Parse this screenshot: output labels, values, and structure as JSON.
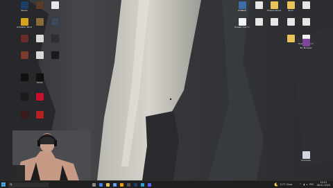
{
  "desktop": {
    "left_icons": [
      {
        "label": "Steam",
        "color": "#1b3f66"
      },
      {
        "label": "",
        "color": "#5a3a28"
      },
      {
        "label": "",
        "color": "#e8e8e8"
      },
      {
        "label": "Activator Windows",
        "color": "#d7a21f"
      },
      {
        "label": "",
        "color": "#8a6a3a"
      },
      {
        "label": "",
        "color": "#3a4a5a"
      },
      {
        "label": "",
        "color": "#6b2b2b"
      },
      {
        "label": "",
        "color": "#d9d9d9"
      },
      {
        "label": "",
        "color": "#2f2f2f"
      },
      {
        "label": "",
        "color": "#7a3b2a"
      },
      {
        "label": "",
        "color": "#d9d9d9"
      },
      {
        "label": "",
        "color": "#1a1a1a"
      },
      {
        "label": "",
        "color": "#101010"
      },
      {
        "label": "TikTok",
        "color": "#111111"
      },
      {
        "label": "",
        "color": "#1b1b1b"
      },
      {
        "label": "",
        "color": "#c8102e"
      },
      {
        "label": "",
        "color": "#3a1a1a"
      },
      {
        "label": "",
        "color": "#b51f1f"
      },
      {
        "label": "",
        "color": "#2b2b2b"
      }
    ],
    "right_icons": [
      {
        "label": "WINRAR",
        "color": "#3c6ea8"
      },
      {
        "label": "",
        "color": "#e6e6e6"
      },
      {
        "label": "Новая папка",
        "color": "#e8c35a"
      },
      {
        "label": "фото",
        "color": "#e8c35a"
      },
      {
        "label": "",
        "color": "#e6e6e6"
      },
      {
        "label": "Новый текстовый",
        "color": "#f2f2f2"
      },
      {
        "label": "",
        "color": "#e6e6e6"
      },
      {
        "label": "",
        "color": "#e6e6e6"
      },
      {
        "label": "",
        "color": "#e6e6e6"
      },
      {
        "label": "",
        "color": "#e6e6e6"
      },
      {
        "label": "",
        "color": "#e8c35a"
      },
      {
        "label": "Новый текстовый",
        "color": "#f2f2f2"
      },
      {
        "label": "Tor Browser",
        "color": "#7d4698"
      },
      {
        "label": "Корзина",
        "color": "#cfd8e0"
      }
    ]
  },
  "taskbar": {
    "search_icon": "search-icon",
    "start_icon": "windows-logo-icon",
    "apps": [
      "task-view-icon",
      "browser-icon",
      "explorer-icon",
      "store-icon",
      "chrome-icon",
      "obs-icon",
      "steam-icon",
      "telegram-icon",
      "discord-icon"
    ],
    "weather": "11°C Clear",
    "lang": "РУС",
    "time": "19:21",
    "date": "08.01.2023"
  }
}
